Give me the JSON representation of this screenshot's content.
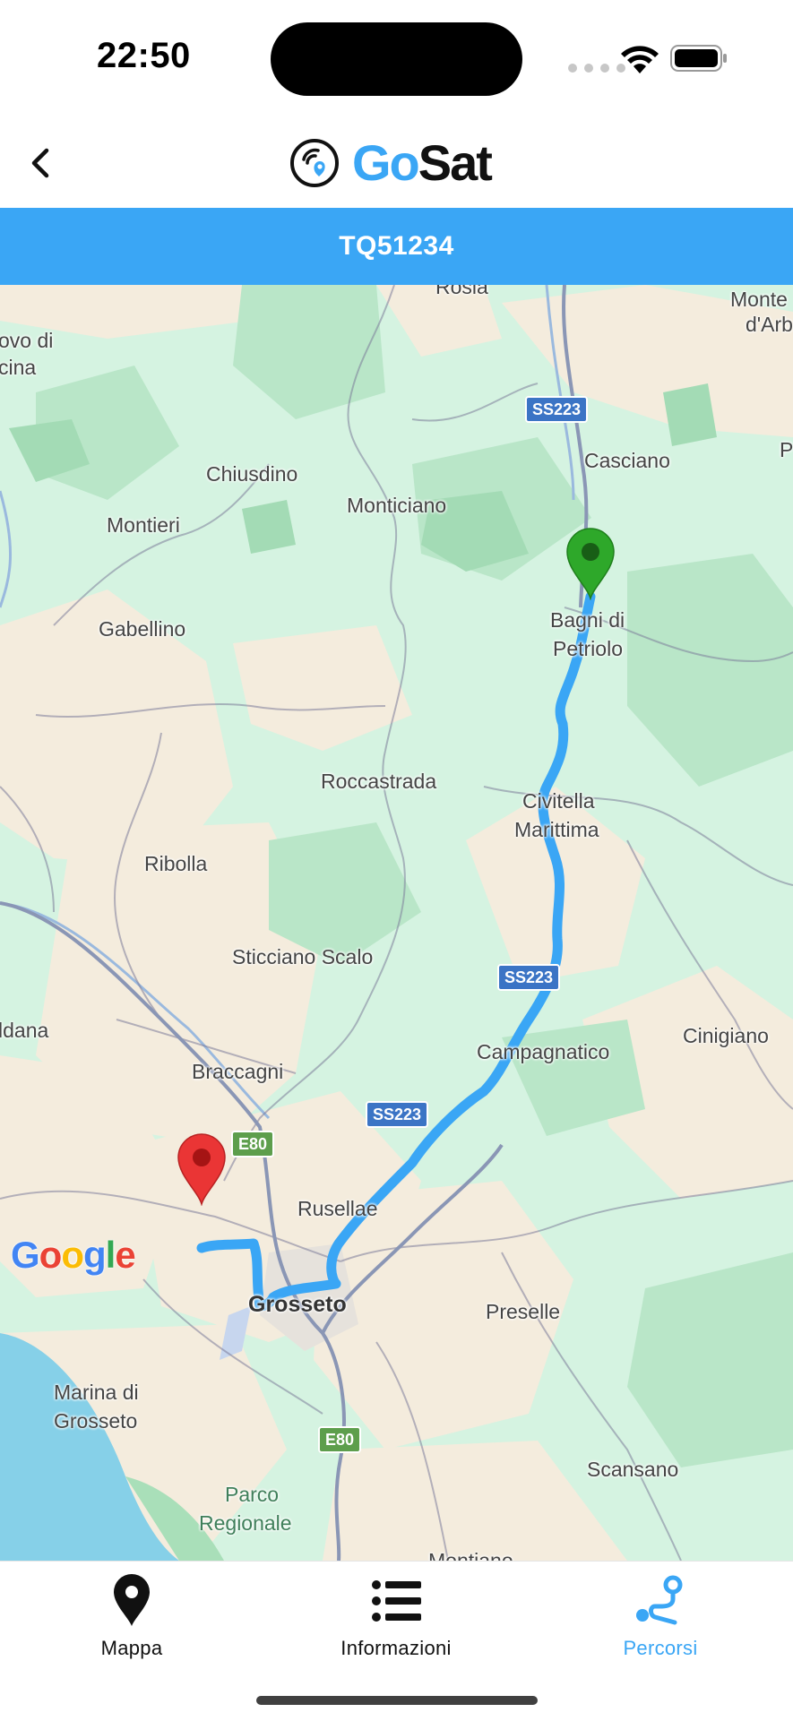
{
  "status_bar": {
    "time": "22:50"
  },
  "header": {
    "brand_prefix": "Go",
    "brand_suffix": "Sat",
    "back_icon": "chevron-left-icon"
  },
  "vehicle": {
    "plate": "TQ51234"
  },
  "map": {
    "labels": {
      "rosia": "Rosia",
      "monte_arbia_1": "Monte",
      "monte_arbia_2": "d'Arb",
      "ovo_di_1": "ovo di",
      "ovo_di_2": "cina",
      "p_edge": "P",
      "casciano": "Casciano",
      "chiusdino": "Chiusdino",
      "monticiano": "Monticiano",
      "montieri": "Montieri",
      "gabellino": "Gabellino",
      "bagni_1": "Bagni di",
      "bagni_2": "Petriolo",
      "roccastrada": "Roccastrada",
      "civitella_1": "Civitella",
      "civitella_2": "Marittima",
      "ribolla": "Ribolla",
      "sticciano": "Sticciano Scalo",
      "ldana": "ldana",
      "cinigiano": "Cinigiano",
      "campagnatico": "Campagnatico",
      "braccagni": "Braccagni",
      "rusellae": "Rusellae",
      "grosseto": "Grosseto",
      "preselle": "Preselle",
      "marina_1": "Marina di",
      "marina_2": "Grosseto",
      "scansano": "Scansano",
      "parco_1": "Parco",
      "parco_2": "Regionale",
      "montiano": "Montiano"
    },
    "shields": {
      "ss223_a": "SS223",
      "ss223_b": "SS223",
      "ss223_c": "SS223",
      "e80_a": "E80",
      "e80_b": "E80"
    },
    "attribution": [
      "G",
      "o",
      "o",
      "g",
      "l",
      "e"
    ],
    "route_color": "#3aa6f5",
    "start_pin_color": "#2ea82a",
    "end_pin_color": "#ea3535"
  },
  "tabs": [
    {
      "label": "Mappa",
      "icon": "map-pin-icon",
      "active": false
    },
    {
      "label": "Informazioni",
      "icon": "list-icon",
      "active": false
    },
    {
      "label": "Percorsi",
      "icon": "route-icon",
      "active": true
    }
  ],
  "colors": {
    "accent": "#3aa6f5"
  }
}
